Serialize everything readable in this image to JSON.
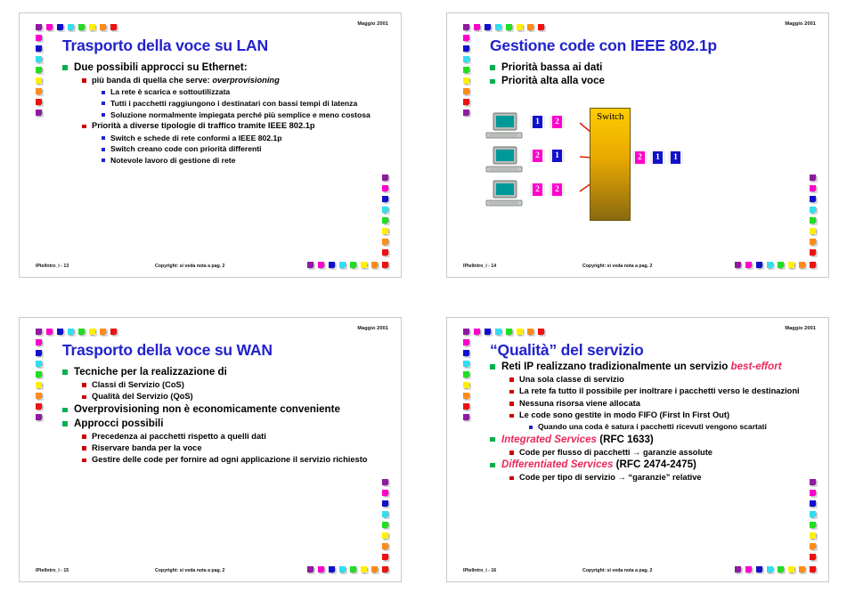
{
  "palette": {
    "squares": [
      "#8E1BA0",
      "#FF00CC",
      "#1111CC",
      "#33DDEE",
      "#22DD22",
      "#FFF000",
      "#FF8C1A",
      "#EE1111"
    ],
    "title_color": "#2222CC",
    "bullet_l1": "#00B050",
    "bullet_l2": "#CC0000",
    "bullet_l3": "#2222CC",
    "accent_red": "#E8285A"
  },
  "slides": [
    {
      "id": "slide-13",
      "date": "Maggio 2001",
      "title": "Trasporto della voce su LAN",
      "footer_left": "IPtelIntro_i - 13",
      "footer_mid": "Copyright: si veda nota a pag. 2",
      "bullets": [
        {
          "level": 1,
          "text": "Due possibili approcci su Ethernet:"
        },
        {
          "level": 2,
          "text": "più banda di quella che serve: ",
          "italic_tail": "overprovisioning"
        },
        {
          "level": 3,
          "text": "La rete è scarica e sottoutilizzata"
        },
        {
          "level": 3,
          "text": "Tutti i pacchetti raggiungono i destinatari con bassi tempi di latenza",
          "justify": true
        },
        {
          "level": 3,
          "text": "Soluzione normalmente impiegata perché più semplice e meno costosa",
          "justify": true
        },
        {
          "level": 2,
          "text": "Priorità a diverse tipologie di traffico tramite IEEE 802.1p"
        },
        {
          "level": 3,
          "text": "Switch e  schede di rete conformi a IEEE 802.1p"
        },
        {
          "level": 3,
          "text": "Switch creano code con priorità differenti"
        },
        {
          "level": 3,
          "text": "Notevole lavoro di gestione di rete"
        }
      ]
    },
    {
      "id": "slide-14",
      "date": "Maggio 2001",
      "title": "Gestione code con IEEE 802.1p",
      "footer_left": "IPtelIntro_i - 14",
      "footer_mid": "Copyright: si veda nota a pag. 2",
      "bullets": [
        {
          "level": 1,
          "text": "Priorità bassa ai dati"
        },
        {
          "level": 1,
          "text": "Priorità alta alla voce"
        }
      ],
      "diagram": {
        "switch_label": "Switch",
        "input_rows": [
          {
            "packets": [
              "1",
              "2"
            ],
            "colors": [
              "b",
              "m"
            ]
          },
          {
            "packets": [
              "2",
              "1"
            ],
            "colors": [
              "m",
              "b"
            ]
          },
          {
            "packets": [
              "2",
              "2"
            ],
            "colors": [
              "m",
              "m"
            ]
          }
        ],
        "output_packets": [
          "2",
          "1",
          "1"
        ],
        "output_colors": [
          "m",
          "b",
          "b"
        ],
        "hosts": 3,
        "arrows": 3
      }
    },
    {
      "id": "slide-15",
      "date": "Maggio 2001",
      "title": "Trasporto della voce su WAN",
      "footer_left": "IPtelIntro_i - 15",
      "footer_mid": "Copyright: si veda nota a pag. 2",
      "bullets": [
        {
          "level": 1,
          "text": "Tecniche per la realizzazione di"
        },
        {
          "level": 2,
          "text": "Classi di Servizio (CoS)"
        },
        {
          "level": 2,
          "text": "Qualità del Servizio (QoS)"
        },
        {
          "level": 1,
          "text": "Overprovisioning non è economicamente conveniente",
          "justify": true
        },
        {
          "level": 1,
          "text": "Approcci possibili"
        },
        {
          "level": 2,
          "text": "Precedenza ai pacchetti rispetto a quelli dati"
        },
        {
          "level": 2,
          "text": "Riservare banda per la voce"
        },
        {
          "level": 2,
          "text": "Gestire delle code per fornire ad ogni applicazione il servizio richiesto",
          "justify": true
        }
      ]
    },
    {
      "id": "slide-16",
      "date": "Maggio 2001",
      "title": "“Qualità” del servizio",
      "footer_left": "IPtelIntro_i - 16",
      "footer_mid": "Copyright: si veda nota a pag. 2",
      "bullets": [
        {
          "level": 1,
          "text": "Reti IP realizzano tradizionalmente un servizio ",
          "red_italic_tail": "best-effort",
          "justify": true
        },
        {
          "level": 2,
          "text": "Una sola classe di servizio"
        },
        {
          "level": 2,
          "text": "La rete fa tutto il possibile per inoltrare i pacchetti verso le destinazioni"
        },
        {
          "level": 2,
          "text": "Nessuna risorsa viene allocata"
        },
        {
          "level": 2,
          "text": "Le code sono gestite in modo FIFO (First In First Out)"
        },
        {
          "level": 3,
          "text": "Quando una coda è satura i pacchetti ricevuti vengono scartati",
          "justify": true
        },
        {
          "level": 1,
          "red_italic_lead": "Integrated Services",
          "text": " (RFC 1633)"
        },
        {
          "level": 2,
          "text": "Code per flusso di pacchetti → garanzie assolute"
        },
        {
          "level": 1,
          "red_italic_lead": "Differentiated Services",
          "text": " (RFC 2474-2475)"
        },
        {
          "level": 2,
          "text": "Code per tipo di servizio → “garanzie” relative"
        }
      ]
    }
  ]
}
